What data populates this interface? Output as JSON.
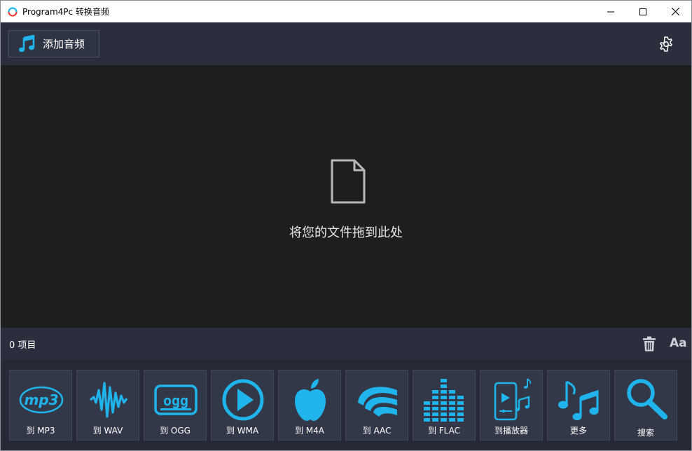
{
  "window": {
    "title": "Program4Pc 转换音频"
  },
  "toolbar": {
    "add_audio_label": "添加音频"
  },
  "dropzone": {
    "text": "将您的文件拖到此处"
  },
  "status": {
    "count_text": "0 项目",
    "font_size_label": "Aa"
  },
  "formats": [
    {
      "label": "到 MP3",
      "icon": "mp3-icon"
    },
    {
      "label": "到 WAV",
      "icon": "waveform-icon"
    },
    {
      "label": "到 OGG",
      "icon": "ogg-icon"
    },
    {
      "label": "到 WMA",
      "icon": "play-circle-icon"
    },
    {
      "label": "到 M4A",
      "icon": "apple-icon"
    },
    {
      "label": "到 AAC",
      "icon": "aac-wave-icon"
    },
    {
      "label": "到 FLAC",
      "icon": "equalizer-icon"
    },
    {
      "label": "到播放器",
      "icon": "phone-music-icon"
    },
    {
      "label": "更多",
      "icon": "music-notes-icon"
    },
    {
      "label": "搜索",
      "icon": "search-icon"
    }
  ],
  "colors": {
    "accent": "#1fb5ec",
    "toolbar_bg": "#2b2f3d",
    "dropzone_bg": "#1e1e1e"
  }
}
